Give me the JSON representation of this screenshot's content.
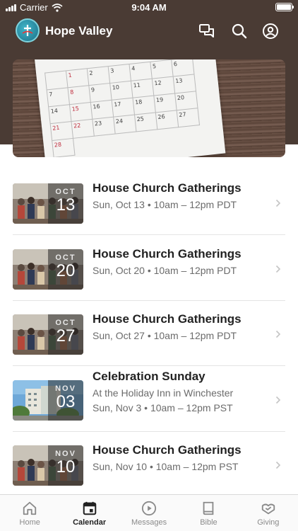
{
  "status_bar": {
    "carrier": "Carrier",
    "time": "9:04 AM",
    "battery_level": 1.0
  },
  "header": {
    "title": "Hope Valley",
    "icons": [
      "logo-icon",
      "chat-icon",
      "search-icon",
      "profile-icon"
    ]
  },
  "hero": {
    "calendar_days": [
      "1",
      "2",
      "3",
      "4",
      "5",
      "6",
      "7",
      "8",
      "9",
      "10",
      "11",
      "12",
      "13",
      "14",
      "15",
      "16",
      "17",
      "18",
      "19",
      "20",
      "21",
      "22",
      "23",
      "24",
      "25",
      "26",
      "27",
      "28"
    ]
  },
  "events": [
    {
      "month": "OCT",
      "day": "13",
      "title": "House Church Gatherings",
      "subtitle": "Sun, Oct 13 • 10am – 12pm PDT"
    },
    {
      "month": "OCT",
      "day": "20",
      "title": "House Church Gatherings",
      "subtitle": "Sun, Oct 20 • 10am – 12pm PDT"
    },
    {
      "month": "OCT",
      "day": "27",
      "title": "House Church Gatherings",
      "subtitle": "Sun, Oct 27 • 10am – 12pm PDT"
    },
    {
      "month": "NOV",
      "day": "03",
      "title": "Celebration Sunday",
      "location": "At the Holiday Inn in Winchester",
      "subtitle": "Sun, Nov 3 • 10am – 12pm PST"
    },
    {
      "month": "NOV",
      "day": "10",
      "title": "House Church Gatherings",
      "subtitle": "Sun, Nov 10 • 10am – 12pm PST"
    }
  ],
  "tabs": [
    {
      "label": "Home",
      "icon": "home-icon",
      "active": false
    },
    {
      "label": "Calendar",
      "icon": "calendar-icon",
      "active": true
    },
    {
      "label": "Messages",
      "icon": "play-icon",
      "active": false
    },
    {
      "label": "Bible",
      "icon": "book-icon",
      "active": false
    },
    {
      "label": "Giving",
      "icon": "giving-icon",
      "active": false
    }
  ],
  "colors": {
    "header_bg": "#4a3b34",
    "accent_active": "#222222",
    "inactive": "#8a8a8a"
  }
}
